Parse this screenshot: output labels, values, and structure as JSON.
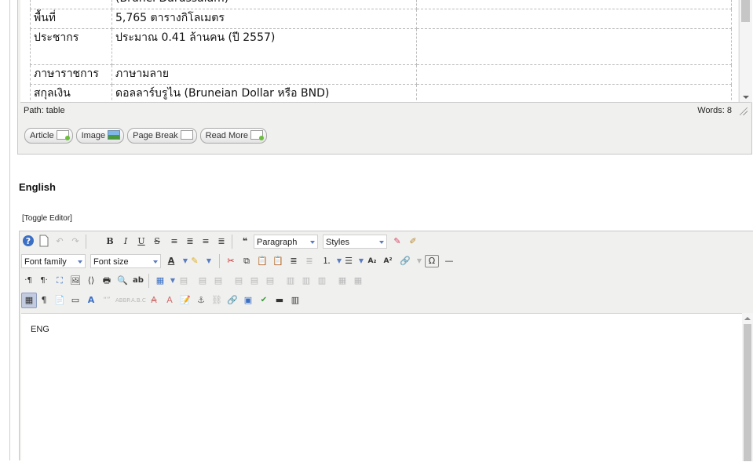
{
  "thai_table": {
    "rows": [
      {
        "label": "",
        "value": "(Brunei Darussalam)"
      },
      {
        "label": "พื้นที่",
        "value": "5,765 ตารางกิโลเมตร"
      },
      {
        "label": "ประชากร",
        "value": "ประมาณ 0.41 ล้านคน (ปี 2557)"
      },
      {
        "label": "ภาษาราชการ",
        "value": "ภาษามลาย"
      },
      {
        "label": "สกุลเงิน",
        "value": "ดอลลาร์บรูไน (Bruneian Dollar หรือ BND)"
      }
    ]
  },
  "status_bar": {
    "path": "Path: table",
    "words": "Words: 8"
  },
  "editor_buttons": [
    {
      "label": "Article",
      "icon": "article-icon"
    },
    {
      "label": "Image",
      "icon": "image-icon"
    },
    {
      "label": "Page Break",
      "icon": "pagebreak-icon"
    },
    {
      "label": "Read More",
      "icon": "readmore-icon"
    }
  ],
  "english_section": {
    "title": "English",
    "toggle_label": "[Toggle Editor]",
    "format_select": "Paragraph",
    "styles_select": "Styles",
    "font_family_select": "Font family",
    "font_size_select": "Font size",
    "content": "ENG"
  },
  "colors": {
    "toolbar_bg": "#f0f0ee",
    "border": "#c8c8c8",
    "active_button": "#c2cbe0"
  }
}
